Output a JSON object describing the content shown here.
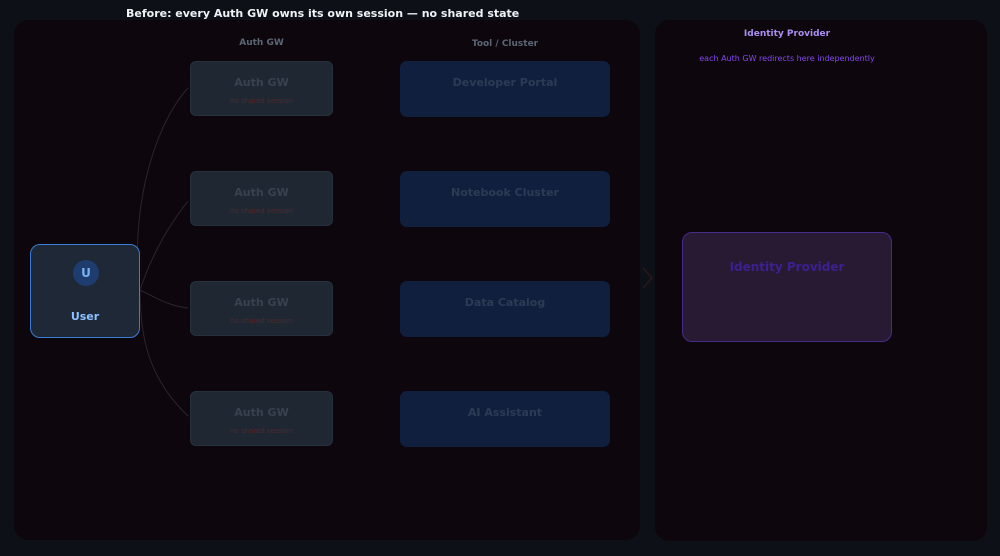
{
  "title": "Before: every Auth GW owns its own session — no shared state",
  "columns": {
    "auth_gw": "Auth GW",
    "tool": "Tool / Cluster"
  },
  "user": {
    "avatar_initial": "U",
    "label": "User"
  },
  "gateways": [
    {
      "title": "Auth GW",
      "note": "no shared session"
    },
    {
      "title": "Auth GW",
      "note": "no shared session"
    },
    {
      "title": "Auth GW",
      "note": "no shared session"
    },
    {
      "title": "Auth GW",
      "note": "no shared session"
    }
  ],
  "tools": [
    {
      "title": "Developer Portal"
    },
    {
      "title": "Notebook Cluster"
    },
    {
      "title": "Data Catalog"
    },
    {
      "title": "AI Assistant"
    }
  ],
  "identity_provider": {
    "heading": "Identity Provider",
    "subtitle": "each Auth GW redirects here independently",
    "box_title": "Identity Provider"
  },
  "colors": {
    "background": "#0d1117",
    "panel": "#0d070d",
    "user_border": "#3a7bd5",
    "tool_fill": "#111f3f",
    "idp_fill": "#281a33",
    "idp_accent": "#8446f0",
    "warning": "#5a2626"
  }
}
